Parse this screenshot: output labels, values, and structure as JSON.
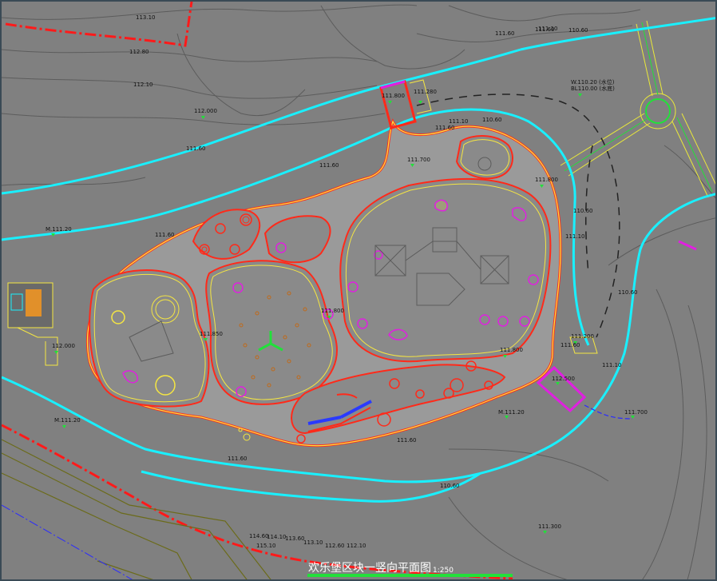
{
  "drawing": {
    "title": "欢乐堡区块一竖向平面图",
    "scale": "1:250"
  },
  "elevations": [
    "113.10",
    "112.80",
    "112.10",
    "112.000",
    "111.60",
    "111.60",
    "111.60",
    "111.60",
    "111.800",
    "111.280",
    "111.60",
    "111.10",
    "110.60",
    "111.700",
    "111.800",
    "111.60",
    "111.10",
    "110.60",
    "W.110.20 (水位)",
    "BL110.00 (水底)",
    "M.111.20",
    "111.60",
    "111.800",
    "111.850",
    "112.000",
    "111.800",
    "111.200",
    "111.10",
    "112.500",
    "111.700",
    "M.111.20",
    "M.111.20",
    "111.60",
    "111.60",
    "110.60",
    "111.300",
    "114.60",
    "114.10",
    "113.60",
    "113.10",
    "112.60",
    "112.10",
    "115.10",
    "110.60",
    "111.10",
    "110.60"
  ],
  "colors": {
    "background": "#808080",
    "path_edge": "#ff2a1a",
    "path_inner": "#f5e642",
    "water_edge": "#19f0ff",
    "marker": "#22e03a",
    "boundary": "#ff1a1a",
    "site_line": "#6b6b1a"
  }
}
